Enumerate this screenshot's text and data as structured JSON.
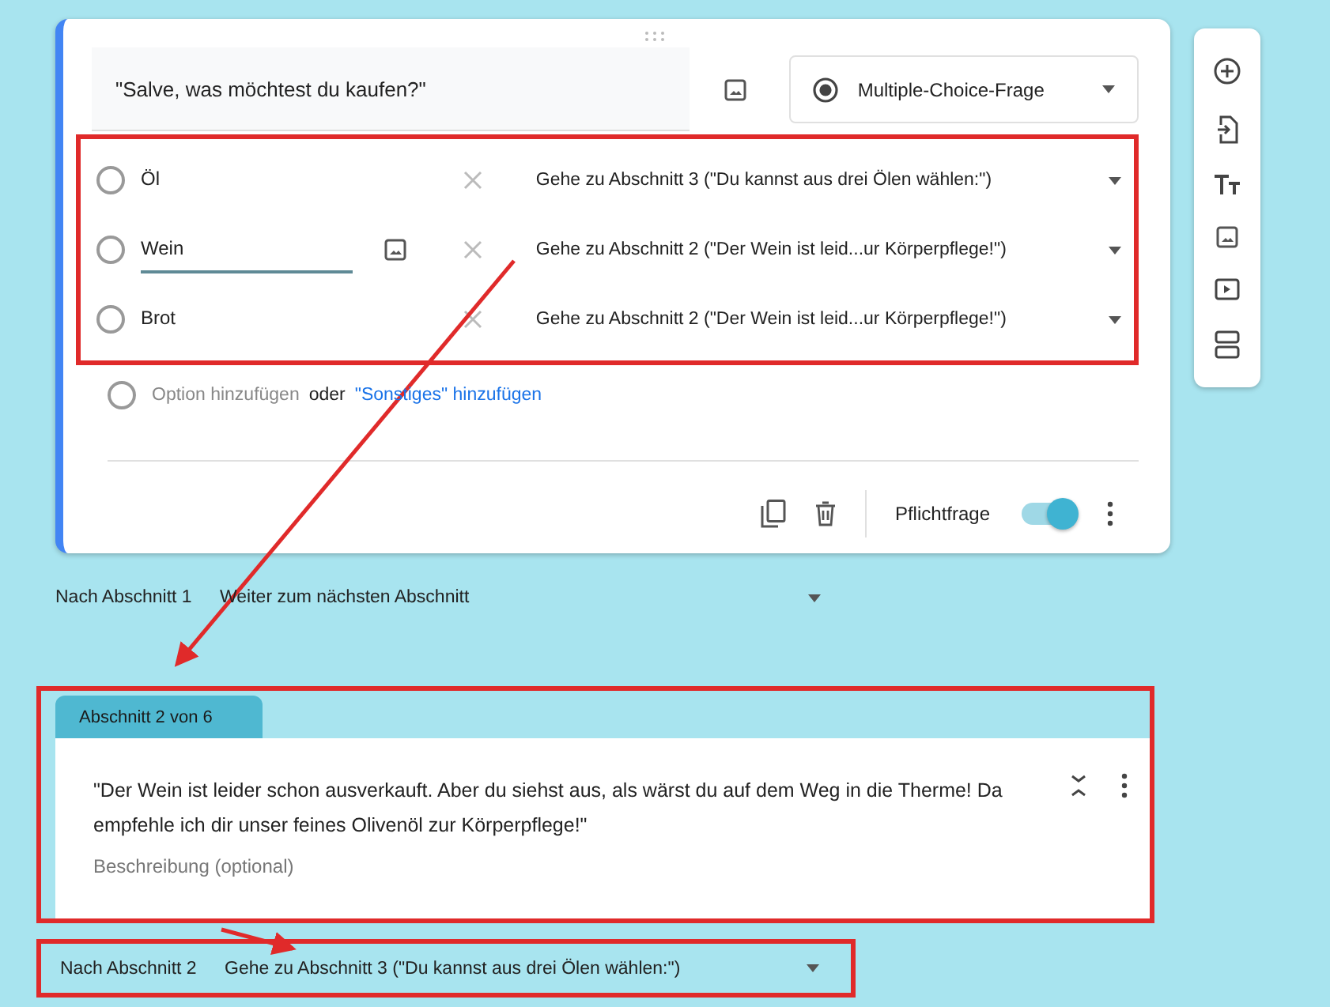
{
  "question": {
    "title": "\"Salve, was möchtest du kaufen?\"",
    "type": "Multiple-Choice-Frage",
    "options": [
      {
        "label": "Öl",
        "checked": false,
        "editing": false,
        "destination": "Gehe zu Abschnitt 3 (\"Du kannst aus drei Ölen wählen:\")"
      },
      {
        "label": "Wein",
        "checked": false,
        "editing": true,
        "destination": "Gehe zu Abschnitt 2 (\"Der Wein ist leid...ur Körperpflege!\")"
      },
      {
        "label": "Brot",
        "checked": false,
        "editing": false,
        "destination": "Gehe zu Abschnitt 2 (\"Der Wein ist leid...ur Körperpflege!\")"
      }
    ],
    "add_option": "Option hinzufügen",
    "or": "oder",
    "add_other": "\"Sonstiges\" hinzufügen",
    "required_label": "Pflichtfrage",
    "required": true
  },
  "after_section_1": {
    "label": "Nach Abschnitt 1",
    "value": "Weiter zum nächsten Abschnitt"
  },
  "section": {
    "tab": "Abschnitt 2 von 6",
    "title": "\"Der Wein ist leider schon ausverkauft. Aber du siehst aus, als wärst du auf dem Weg in die Therme! Da empfehle ich dir unser feines Olivenöl zur Körperpflege!\"",
    "description_placeholder": "Beschreibung (optional)"
  },
  "after_section_2": {
    "label": "Nach Abschnitt 2",
    "value": "Gehe zu Abschnitt 3 (\"Du kannst aus drei Ölen wählen:\")"
  }
}
